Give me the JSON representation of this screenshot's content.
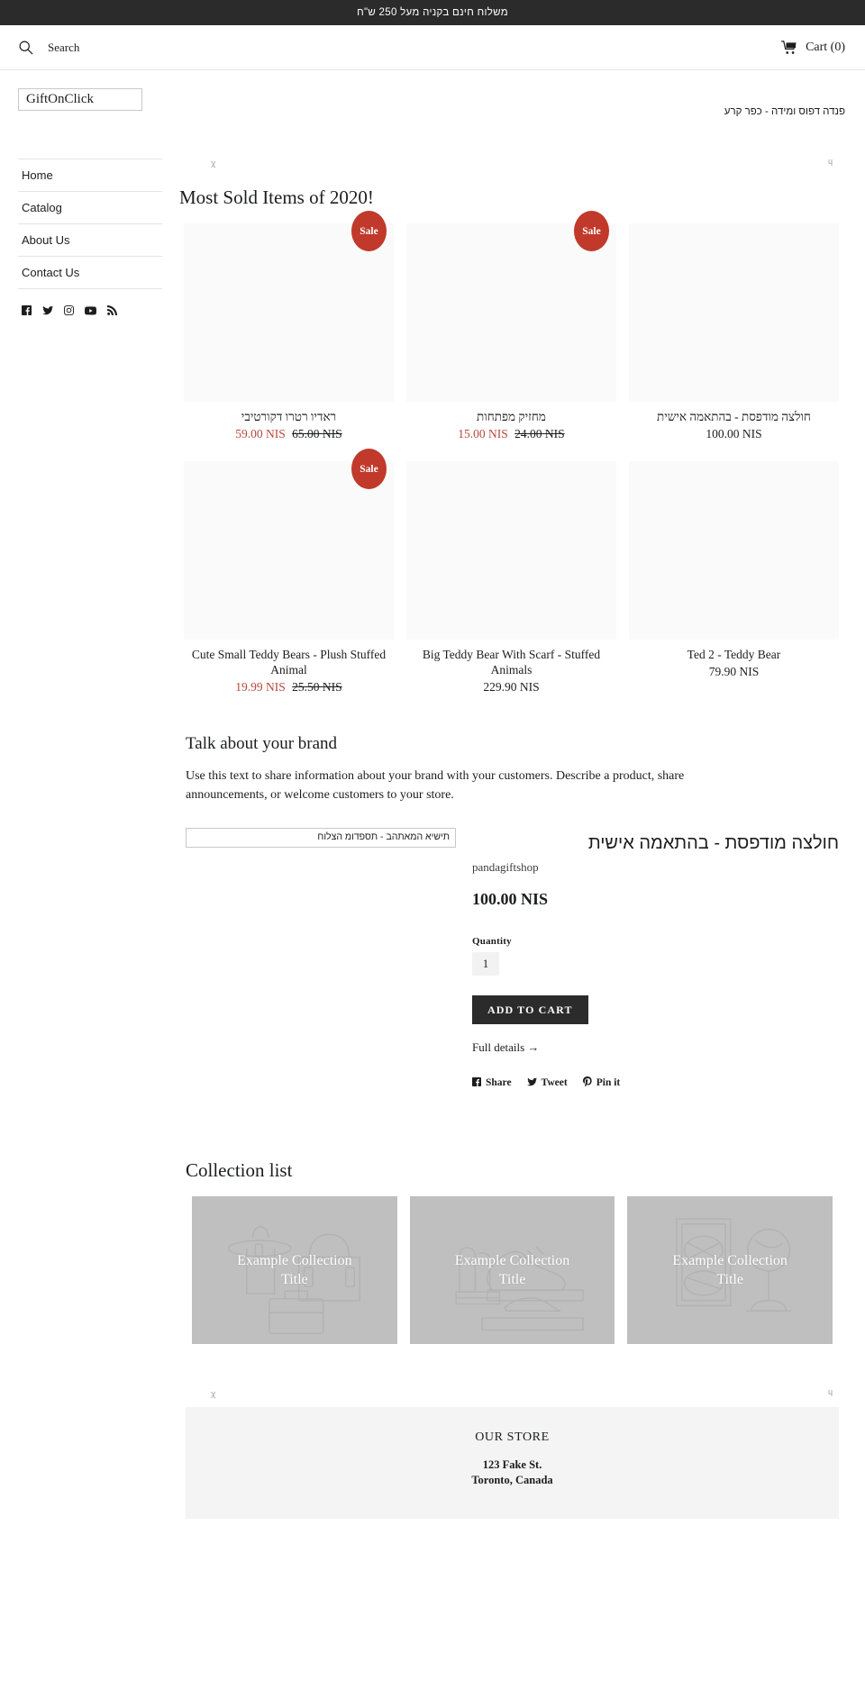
{
  "announcement": {
    "text": "משלוח חינם בקניה מעל 250 ש\"ח"
  },
  "header": {
    "search_label": "Search",
    "search_icon": "search-icon",
    "cart_label": "Cart (0)",
    "cart_icon": "cart-icon"
  },
  "branding": {
    "logo_text": "GiftOnClick",
    "tagline": "פנדה דפוס ומידה - כפר קרע"
  },
  "sidebar": {
    "items": [
      {
        "label": "Home"
      },
      {
        "label": "Catalog"
      },
      {
        "label": "About Us"
      },
      {
        "label": "Contact Us"
      }
    ],
    "social": [
      {
        "name": "facebook-icon"
      },
      {
        "name": "twitter-icon"
      },
      {
        "name": "instagram-icon"
      },
      {
        "name": "youtube-icon"
      },
      {
        "name": "rss-icon"
      }
    ]
  },
  "markers": {
    "left": "ꭓ",
    "right": "ɥ"
  },
  "featured_collection": {
    "title": "Most Sold Items of 2020!",
    "sale_badge_label": "Sale",
    "products": [
      {
        "title": "ראדיו רטרו דקורטיבי",
        "rtl": true,
        "on_sale": true,
        "price": "59.00 NIS",
        "compare_price": "65.00 NIS"
      },
      {
        "title": "מחזיק מפתחות",
        "rtl": true,
        "on_sale": true,
        "price": "15.00 NIS",
        "compare_price": "24.00 NIS"
      },
      {
        "title": "חולצה מודפסת - בהתאמה אישית",
        "rtl": true,
        "on_sale": false,
        "price": "100.00 NIS",
        "compare_price": ""
      },
      {
        "title": "Cute Small Teddy Bears - Plush Stuffed Animal",
        "rtl": false,
        "on_sale": true,
        "price": "19.99 NIS",
        "compare_price": "25.50 NIS"
      },
      {
        "title": "Big Teddy Bear With Scarf - Stuffed Animals",
        "rtl": false,
        "on_sale": false,
        "price": "229.90 NIS",
        "compare_price": ""
      },
      {
        "title": "Ted 2 - Teddy Bear",
        "rtl": false,
        "on_sale": false,
        "price": "79.90 NIS",
        "compare_price": ""
      }
    ]
  },
  "rich_text": {
    "heading": "Talk about your brand",
    "body": "Use this text to share information about your brand with your customers. Describe a product, share announcements, or welcome customers to your store."
  },
  "featured_product": {
    "image_alt": "תישיא המאתהב - תספדומ הצלוח",
    "title": "חולצה מודפסת - בהתאמה אישית",
    "vendor": "pandagiftshop",
    "price": "100.00 NIS",
    "quantity_label": "Quantity",
    "quantity_value": "1",
    "add_to_cart_label": "ADD TO CART",
    "full_details_label": "Full details →",
    "share": [
      {
        "label": "Share",
        "icon": "facebook-icon"
      },
      {
        "label": "Tweet",
        "icon": "twitter-icon"
      },
      {
        "label": "Pin it",
        "icon": "pinterest-icon"
      }
    ]
  },
  "collection_list": {
    "heading": "Collection list",
    "items": [
      {
        "label": "Example Collection Title",
        "art": "bags"
      },
      {
        "label": "Example Collection Title",
        "art": "shoes"
      },
      {
        "label": "Example Collection Title",
        "art": "accessories"
      }
    ]
  },
  "footer": {
    "heading": "OUR STORE",
    "address_line1": "123 Fake St.",
    "address_line2": "Toronto, Canada"
  },
  "colors": {
    "announcement_bg": "#2b2b2b",
    "sale_badge": "#c0392b",
    "sale_price": "#b5483c",
    "button": "#2b2b2b",
    "collection_tile": "#bfbfbf",
    "footer_bg": "#f4f4f4"
  }
}
